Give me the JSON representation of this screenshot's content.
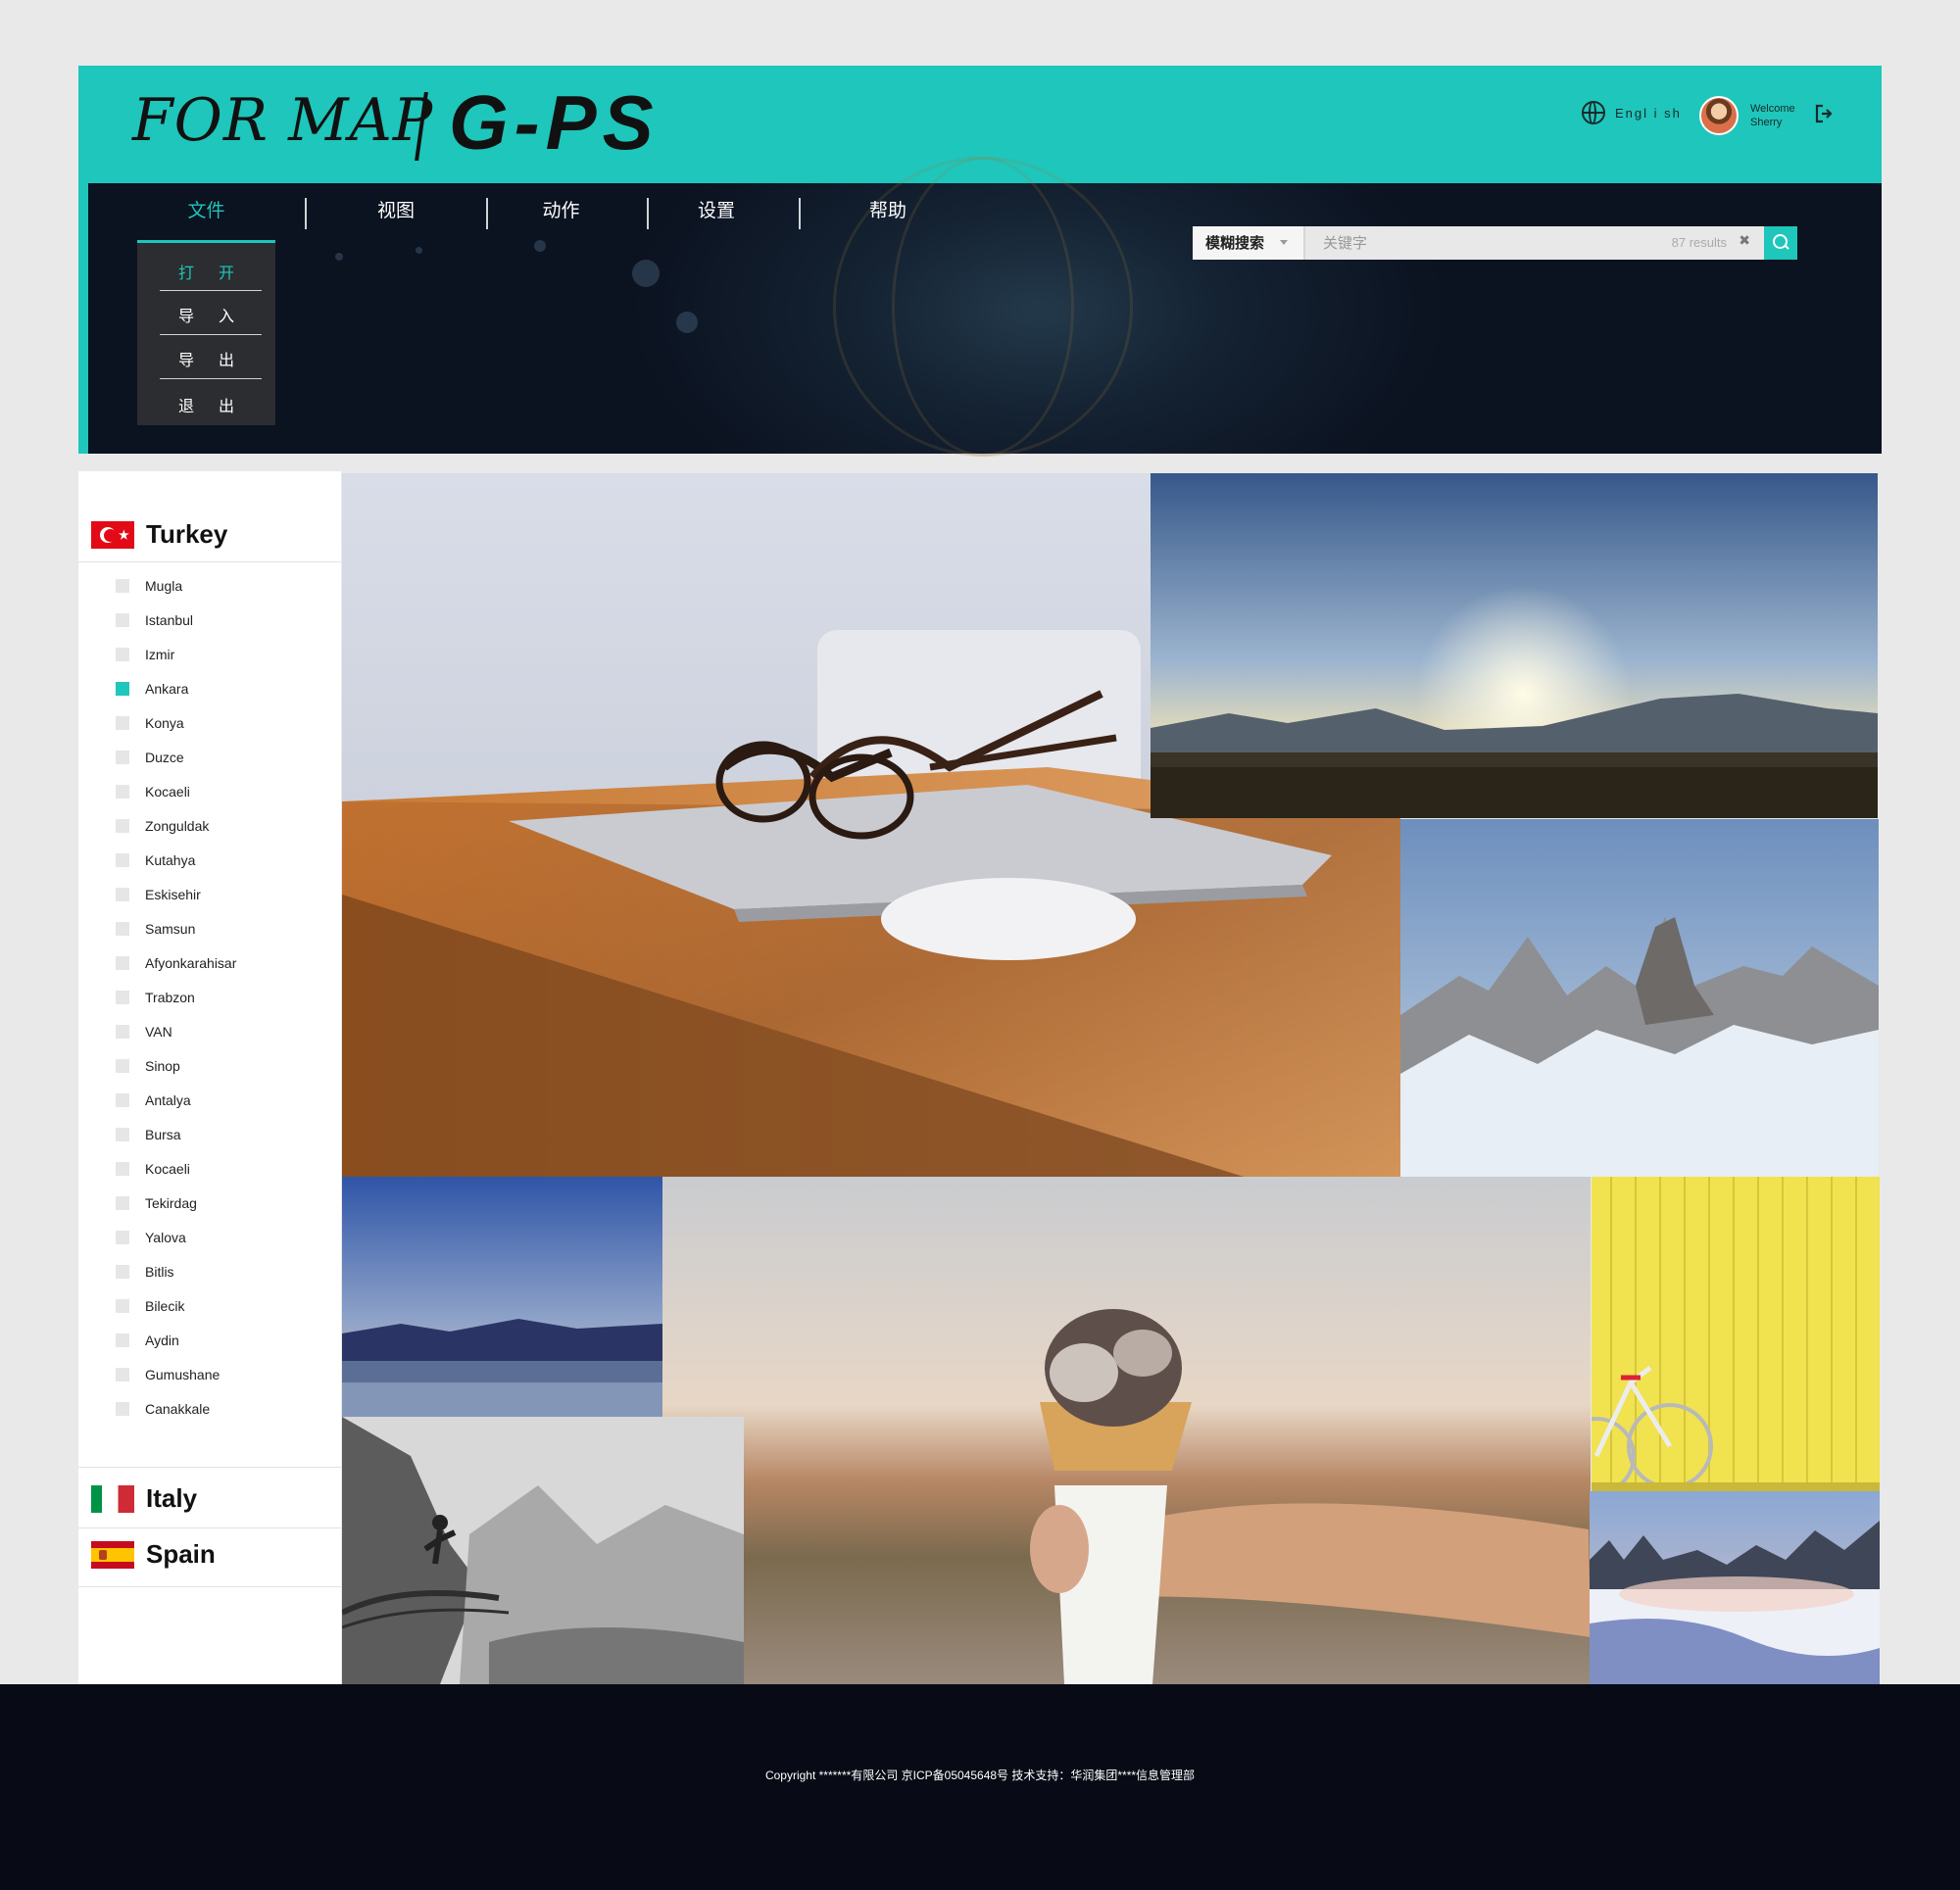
{
  "brand": {
    "logo_left": "FOR MAP",
    "logo_right": "G-PS"
  },
  "header": {
    "language": "Engl i sh",
    "welcome": "Welcome",
    "username": "Sherry"
  },
  "nav": {
    "items": [
      "文件",
      "视图",
      "动作",
      "设置",
      "帮助"
    ],
    "active": "文件",
    "dropdown": [
      "打 开",
      "导 入",
      "导 出",
      "退 出"
    ]
  },
  "search": {
    "type_label": "模糊搜索",
    "placeholder": "关键字",
    "results": "87 results",
    "clear": "✖"
  },
  "sidebar": {
    "countries": [
      {
        "name": "Turkey",
        "flag": "turkey-flag-icon"
      },
      {
        "name": "Italy",
        "flag": "italy-flag-icon"
      },
      {
        "name": "Spain",
        "flag": "spain-flag-icon"
      }
    ],
    "cities": [
      "Mugla",
      "Istanbul",
      "Izmir",
      "Ankara",
      "Konya",
      "Duzce",
      "Kocaeli",
      "Zonguldak",
      "Kutahya",
      "Eskisehir",
      "Samsun",
      "Afyonkarahisar",
      "Trabzon",
      "VAN",
      "Sinop",
      "Antalya",
      "Bursa",
      "Kocaeli",
      "Tekirdag",
      "Yalova",
      "Bitlis",
      "Bilecik",
      "Aydin",
      "Gumushane",
      "Canakkale"
    ],
    "selected_city": "Ankara"
  },
  "photos": [
    "laptop-glasses-photo",
    "sunset-mountains-photo",
    "snowy-peaks-photo",
    "lake-mountains-photo",
    "ice-cream-photo",
    "yellow-wall-bicycle-photo",
    "black-white-cliff-photo",
    "frozen-river-forest-photo"
  ],
  "footer": {
    "copyright": "Copyright *******有限公司 京ICP备05045648号 技术支持：华润集团****信息管理部"
  },
  "colors": {
    "accent": "#1ec6bb",
    "banner": "#0b1220",
    "footer": "#080b16"
  }
}
